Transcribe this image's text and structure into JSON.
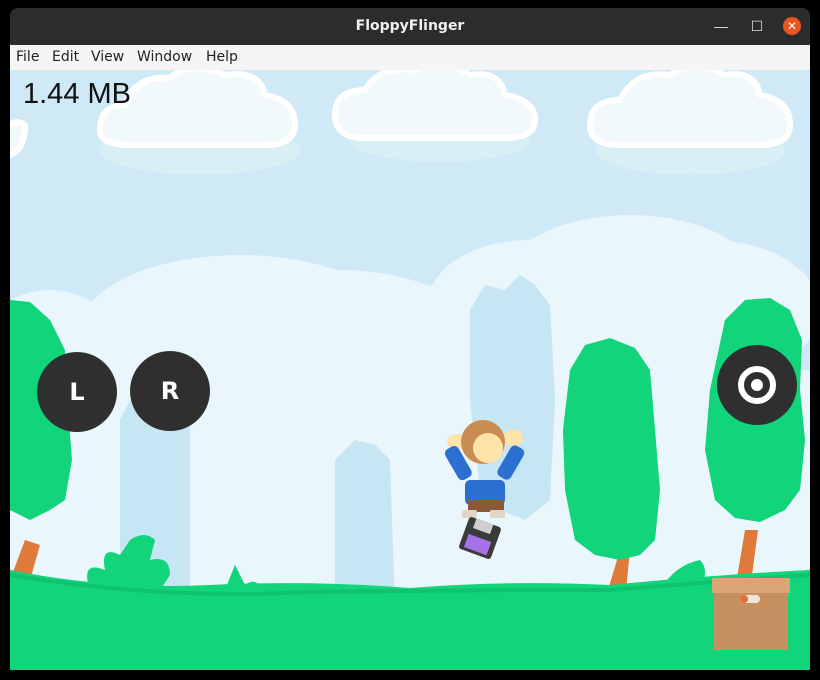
{
  "window": {
    "title": "FloppyFlinger",
    "controls": {
      "minimize": "—",
      "maximize": "☐",
      "close": "✕"
    }
  },
  "menu": {
    "items": [
      "File",
      "Edit",
      "View",
      "Window",
      "Help"
    ]
  },
  "game": {
    "score_text": "1.44 MB",
    "left_button": "L",
    "right_button": "R",
    "action_button_icon": "target-icon",
    "sky_color": "#cfeaf6",
    "ground_color": "#12d47a"
  }
}
